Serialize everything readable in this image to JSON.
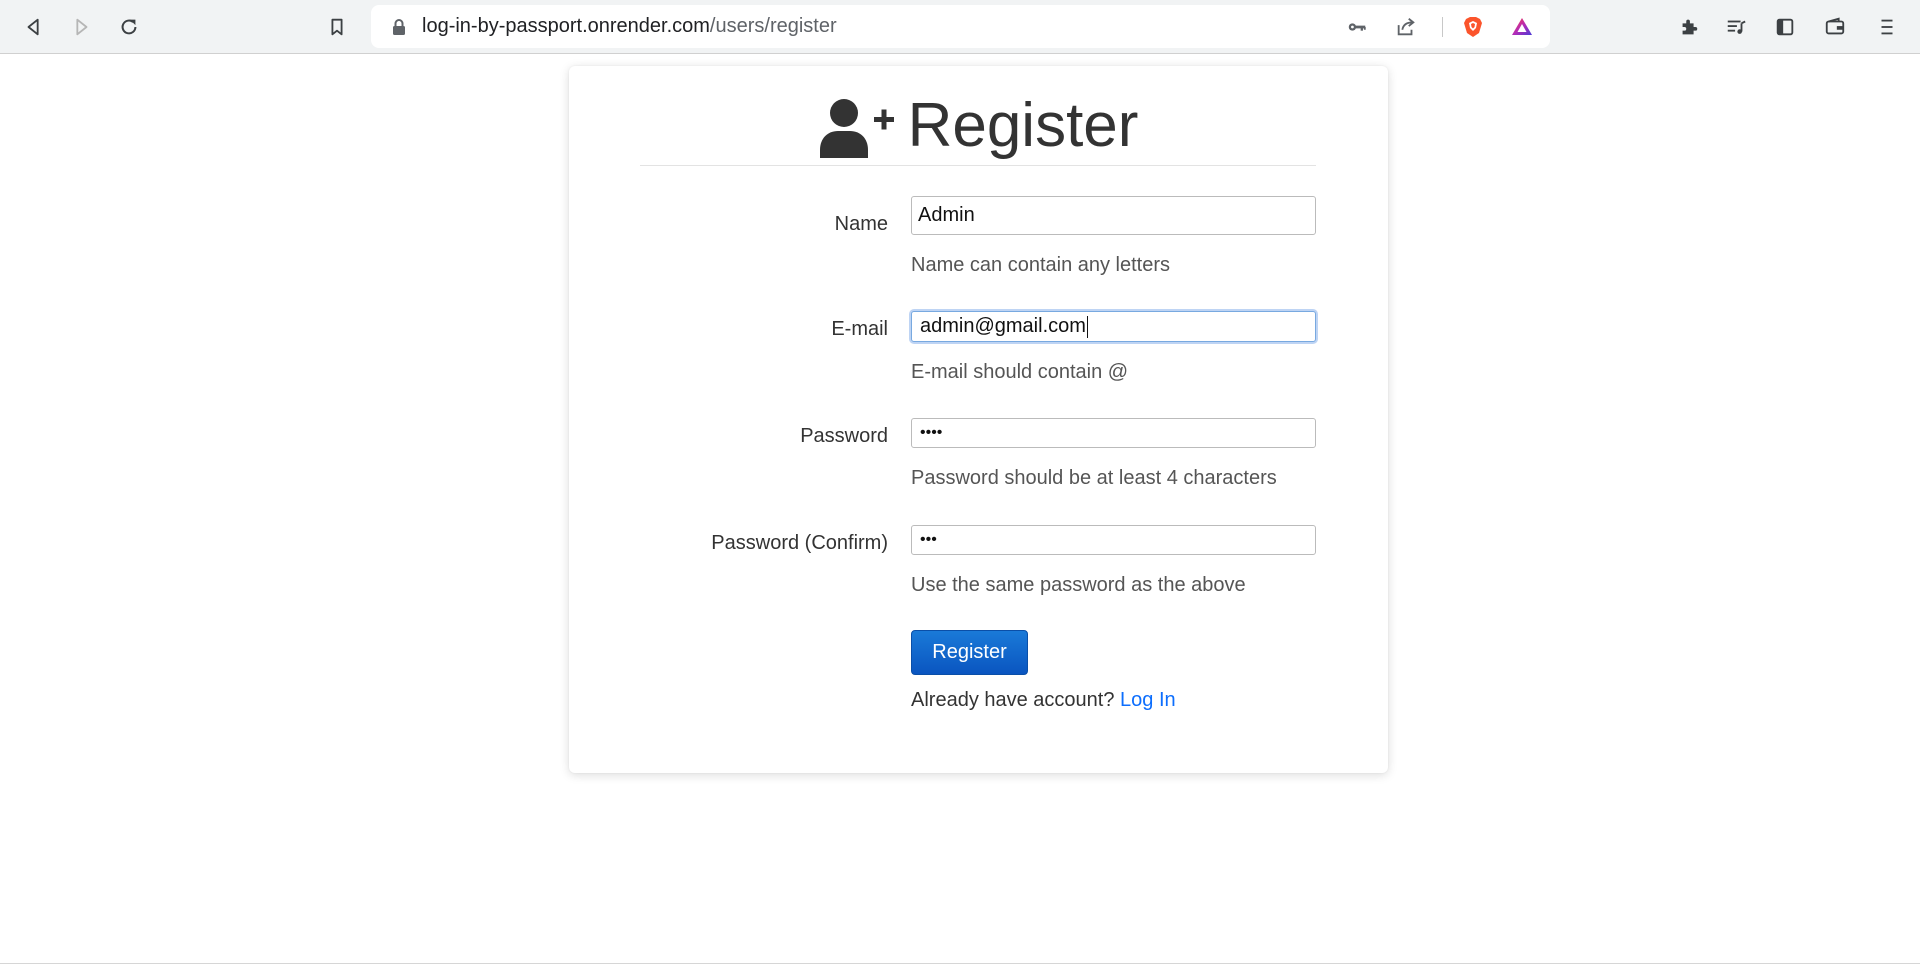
{
  "browser": {
    "url_host": "log-in-by-passport.onrender.com",
    "url_path": "/users/register",
    "icons": {
      "back": "back-arrow-icon",
      "forward": "forward-arrow-icon",
      "reload": "reload-icon",
      "bookmark": "bookmark-icon",
      "lock": "lock-icon",
      "key": "key-icon",
      "share": "share-icon",
      "brave": "brave-shields-icon",
      "rewards": "brave-rewards-icon",
      "extensions": "puzzle-extensions-icon",
      "playlist": "playlist-icon",
      "sidebar": "sidebar-icon",
      "wallet": "wallet-icon",
      "menu": "menu-icon"
    }
  },
  "page": {
    "heading": "Register",
    "heading_icon": "user-plus-icon",
    "fields": [
      {
        "label": "Name",
        "value": "Admin",
        "help": "Name can contain any letters"
      },
      {
        "label": "E-mail",
        "value": "admin@gmail.com",
        "help": "E-mail should contain @"
      },
      {
        "label": "Password",
        "value": "••••",
        "help": "Password should be at least 4 characters"
      },
      {
        "label": "Password (Confirm)",
        "value": "•••",
        "help": "Use the same password as the above"
      }
    ],
    "submit_label": "Register",
    "footer_text": "Already have account?",
    "login_link": "Log In"
  },
  "colors": {
    "accent": "#0d6efd",
    "button": "#0a5fc8",
    "toolbar_bg": "#f1f3f4",
    "brave_orange": "#fb542b"
  }
}
